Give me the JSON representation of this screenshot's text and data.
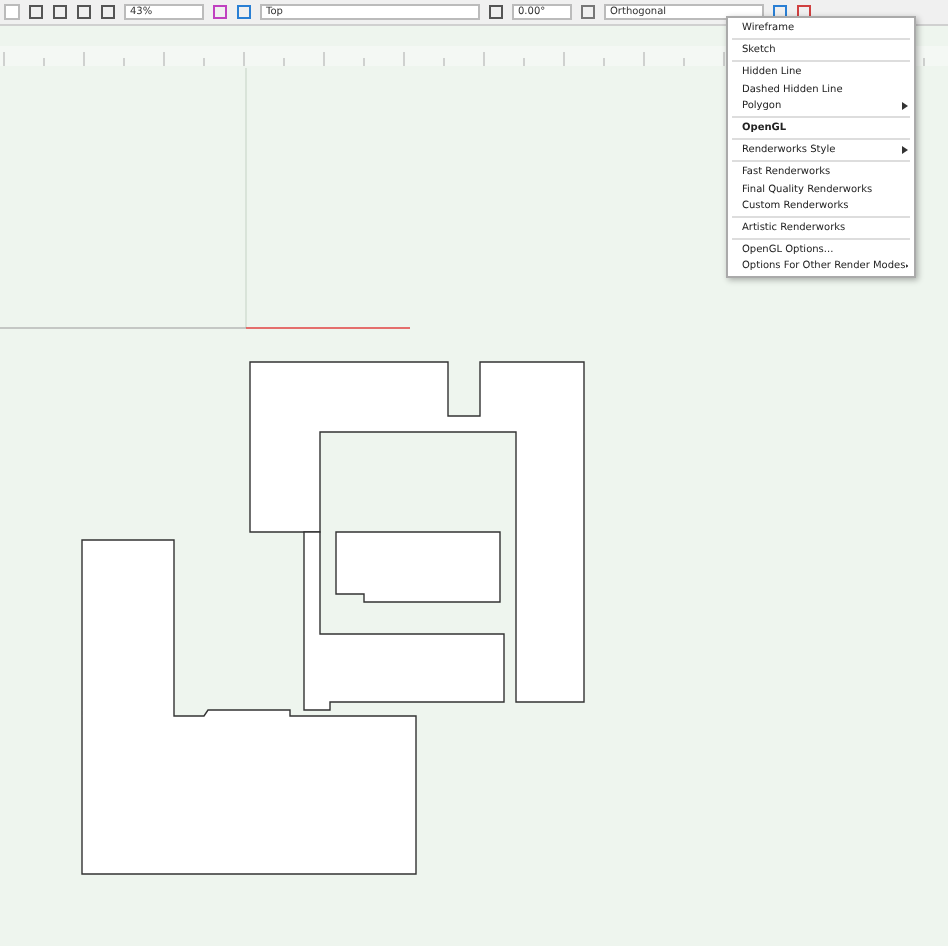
{
  "toolbar": {
    "zoom": "43%",
    "view": "Top",
    "rotation": "0.00°",
    "projection": "Orthogonal"
  },
  "render_menu": {
    "items": [
      {
        "kind": "item",
        "label": "Wireframe",
        "selected": false,
        "submenu": false
      },
      {
        "kind": "separator"
      },
      {
        "kind": "item",
        "label": "Sketch",
        "selected": false,
        "submenu": false
      },
      {
        "kind": "separator"
      },
      {
        "kind": "item",
        "label": "Hidden Line",
        "selected": false,
        "submenu": false
      },
      {
        "kind": "item",
        "label": "Dashed Hidden Line",
        "selected": false,
        "submenu": false
      },
      {
        "kind": "item",
        "label": "Polygon",
        "selected": false,
        "submenu": true
      },
      {
        "kind": "separator"
      },
      {
        "kind": "item",
        "label": "OpenGL",
        "selected": true,
        "submenu": false
      },
      {
        "kind": "separator"
      },
      {
        "kind": "item",
        "label": "Renderworks Style",
        "selected": false,
        "submenu": true
      },
      {
        "kind": "separator"
      },
      {
        "kind": "item",
        "label": "Fast Renderworks",
        "selected": false,
        "submenu": false
      },
      {
        "kind": "item",
        "label": "Final Quality Renderworks",
        "selected": false,
        "submenu": false
      },
      {
        "kind": "item",
        "label": "Custom Renderworks",
        "selected": false,
        "submenu": false
      },
      {
        "kind": "separator"
      },
      {
        "kind": "item",
        "label": "Artistic Renderworks",
        "selected": false,
        "submenu": false
      },
      {
        "kind": "separator"
      },
      {
        "kind": "item",
        "label": "OpenGL Options...",
        "selected": false,
        "submenu": false
      },
      {
        "kind": "item",
        "label": "Options For Other Render Modes",
        "selected": false,
        "submenu": true
      }
    ]
  }
}
